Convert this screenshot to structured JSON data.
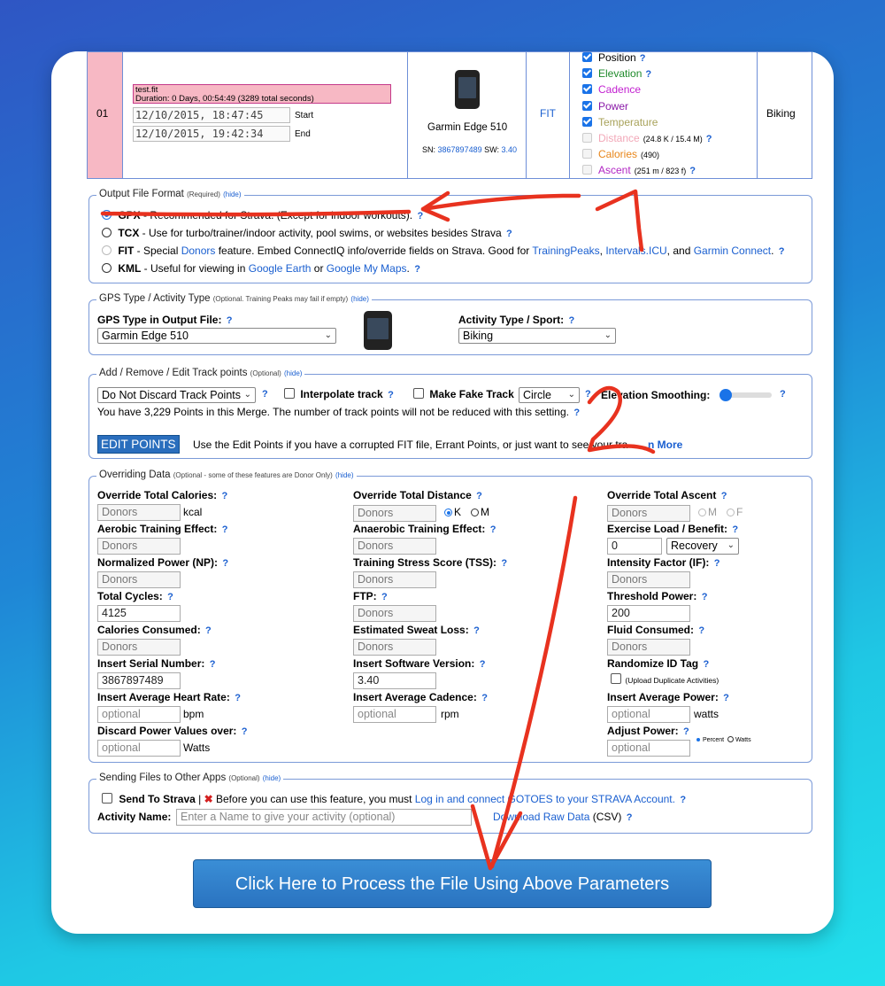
{
  "file_row": {
    "index": "01",
    "file_name": "test.fit",
    "duration": "Duration: 0 Days, 00:54:49 (3289 total seconds)",
    "start_value": "12/10/2015, 18:47:45",
    "start_label": "Start",
    "end_value": "12/10/2015, 19:42:34",
    "end_label": "End",
    "device_name": "Garmin Edge 510",
    "sn_label": "SN:",
    "sn_value": "3867897489",
    "sw_label": "SW:",
    "sw_value": "3.40",
    "file_type": "FIT",
    "sport": "Biking",
    "data_fields": [
      {
        "label": "Position",
        "checked": true,
        "color": "#000000",
        "extra": "",
        "help": "?"
      },
      {
        "label": "Elevation",
        "checked": true,
        "color": "#1e8a2a",
        "extra": "",
        "help": "?"
      },
      {
        "label": "Cadence",
        "checked": true,
        "color": "#c21fd0",
        "extra": "",
        "help": ""
      },
      {
        "label": "Power",
        "checked": true,
        "color": "#8a1aa8",
        "extra": "",
        "help": ""
      },
      {
        "label": "Temperature",
        "checked": true,
        "color": "#a8a25a",
        "extra": "",
        "help": ""
      },
      {
        "label": "Distance",
        "checked": false,
        "color": "#f2a8b8",
        "extra": "(24.8 K / 15.4 M)",
        "help": "?"
      },
      {
        "label": "Calories",
        "checked": false,
        "color": "#e8861a",
        "extra": "(490)",
        "help": ""
      },
      {
        "label": "Ascent",
        "checked": false,
        "color": "#b226c4",
        "extra": "(251 m / 823 f)",
        "help": "?"
      }
    ]
  },
  "output_format": {
    "legend": "Output File Format",
    "legend_note": "(Required)",
    "hide": "(hide)",
    "options": [
      {
        "name": "GPX",
        "desc": " - Recommended for Strava. (Except for indoor workouts).",
        "selected": true
      },
      {
        "name": "TCX",
        "desc": " - Use for turbo/trainer/indoor activity, pool swims, or websites besides Strava",
        "selected": false
      },
      {
        "name": "FIT",
        "desc": " - Special ",
        "selected": false
      },
      {
        "name": "KML",
        "desc": " - Useful for viewing in ",
        "selected": false
      }
    ],
    "fit_link_donors": "Donors",
    "fit_text_2": " feature. Embed ConnectIQ info/override fields on Strava. Good for ",
    "fit_link_tp": "TrainingPeaks",
    "fit_comma": ", ",
    "fit_link_icu": "Intervals.ICU",
    "fit_and": ", and ",
    "fit_link_gc": "Garmin Connect",
    "fit_dot": ".",
    "kml_link_ge": "Google Earth",
    "kml_or": " or ",
    "kml_link_gmm": "Google My Maps",
    "kml_dot": "."
  },
  "gps": {
    "legend": "GPS Type / Activity Type",
    "legend_note": "(Optional. Training Peaks may fail if empty)",
    "hide": "(hide)",
    "gps_label": "GPS Type in Output File:",
    "gps_value": "Garmin Edge 510",
    "activity_label": "Activity Type / Sport:",
    "activity_value": "Biking"
  },
  "trackpoints": {
    "legend": "Add / Remove / Edit Track points",
    "legend_note": "(Optional)",
    "hide": "(hide)",
    "discard_value": "Do Not Discard Track Points",
    "interpolate_label": "Interpolate track",
    "fake_label": "Make Fake Track",
    "fake_value": "Circle",
    "smoothing_label": "Elevation Smoothing:",
    "smoothing_level": 0,
    "points_info": "You have 3,229 Points in this Merge. The number of track points will not be reduced with this setting.",
    "edit_button": "EDIT POINTS",
    "edit_desc": "Use the Edit Points if you have a corrupted FIT file, Errant Points, or just want to see your tra",
    "learn_more": "n More"
  },
  "overriding": {
    "legend": "Overriding Data",
    "legend_note": "(Optional - some of these features are Donor Only)",
    "hide": "(hide)",
    "total_calories_label": "Override Total Calories:",
    "total_calories_value": "Donors",
    "kcal": "kcal",
    "total_distance_label": "Override Total Distance",
    "total_distance_value": "Donors",
    "unit_k": "K",
    "unit_m": "M",
    "total_ascent_label": "Override Total Ascent",
    "total_ascent_value": "Donors",
    "ascent_m": "M",
    "ascent_f": "F",
    "aerobic_label": "Aerobic Training Effect:",
    "aerobic_value": "Donors",
    "anaerobic_label": "Anaerobic Training Effect:",
    "anaerobic_value": "Donors",
    "exercise_label": "Exercise Load / Benefit:",
    "exercise_value": "0",
    "exercise_select": "Recovery",
    "np_label": "Normalized Power (NP):",
    "np_value": "Donors",
    "tss_label": "Training Stress Score (TSS):",
    "tss_value": "Donors",
    "if_label": "Intensity Factor (IF):",
    "if_value": "Donors",
    "cycles_label": "Total Cycles:",
    "cycles_value": "4125",
    "ftp_label": "FTP:",
    "ftp_value": "Donors",
    "threshold_label": "Threshold Power:",
    "threshold_value": "200",
    "cal_consumed_label": "Calories Consumed:",
    "cal_consumed_value": "Donors",
    "sweat_label": "Estimated Sweat Loss:",
    "sweat_value": "Donors",
    "fluid_label": "Fluid Consumed:",
    "fluid_value": "Donors",
    "serial_label": "Insert Serial Number:",
    "serial_value": "3867897489",
    "software_label": "Insert Software Version:",
    "software_value": "3.40",
    "randomize_label": "Randomize ID Tag",
    "randomize_note": "(Upload Duplicate Activities)",
    "hr_label": "Insert Average Heart Rate:",
    "hr_placeholder": "optional",
    "bpm": "bpm",
    "cadence_label": "Insert Average Cadence:",
    "cadence_placeholder": "optional",
    "rpm": "rpm",
    "avg_power_label": "Insert Average Power:",
    "avg_power_placeholder": "optional",
    "watts": "watts",
    "discard_label": "Discard Power Values over:",
    "discard_placeholder": "optional",
    "discard_unit": "Watts",
    "adjust_label": "Adjust Power:",
    "adjust_placeholder": "optional",
    "percent": "Percent",
    "watts_opt": "Watts"
  },
  "sending": {
    "legend": "Sending Files to Other Apps",
    "legend_note": "(Optional)",
    "hide": "(hide)",
    "strava_label": "Send To Strava",
    "sep": " | ",
    "warn_text": " Before you can use this feature, you must ",
    "login_link": "Log in and connect GOTOES to your STRAVA Account.",
    "activity_label": "Activity Name:",
    "activity_placeholder": "Enter a Name to give your activity (optional)",
    "download_link": "Download Raw Data",
    "csv": " (CSV)"
  },
  "process_button": "Click Here to Process the File Using Above Parameters",
  "help": "?",
  "annotations": {
    "arrow_1": "1",
    "arrow_2": "2"
  },
  "colors": {
    "accent": "#1a73e8",
    "link": "#1a5fd0",
    "annotation": "#e8321f",
    "pink": "#f7b8c4"
  }
}
